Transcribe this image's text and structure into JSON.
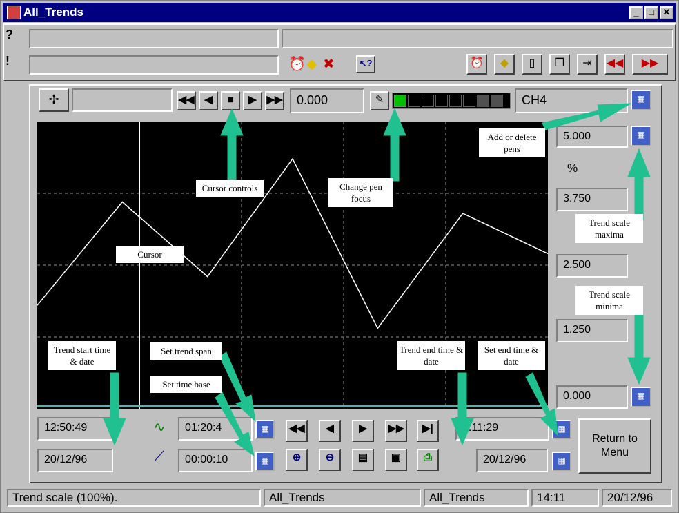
{
  "window": {
    "title": "All_Trends",
    "min_label": "_",
    "max_label": "□",
    "close_label": "✕"
  },
  "menu": {
    "help_label": "?",
    "alert_label": "!"
  },
  "cursor_toolbar": {
    "value": "0.000",
    "pen_name": "CH4",
    "btn_rewind": "◀◀",
    "btn_back": "◀",
    "btn_stop": "■",
    "btn_fwd": "▶",
    "btn_ffwd": "▶▶"
  },
  "scale": {
    "max": "5.000",
    "unit": "%",
    "v3750": "3.750",
    "v2500": "2.500",
    "v1250": "1.250",
    "min": "0.000"
  },
  "bottom": {
    "start_time": "12:50:49",
    "start_date": "20/12/96",
    "span": "01:20:4",
    "time_base": "00:00:10",
    "end_time": "4:11:29",
    "end_date": "20/12/96",
    "return_label": "Return to Menu"
  },
  "statusbar": {
    "message": "Trend scale (100%).",
    "panel2": "All_Trends",
    "panel3": "All_Trends",
    "time": "14:11",
    "date": "20/12/96"
  },
  "annotations": {
    "cursor_controls": "Cursor controls",
    "change_pen": "Change pen focus",
    "add_pens": "Add or delete pens",
    "cursor": "Cursor",
    "scale_max": "Trend scale maxima",
    "scale_min": "Trend scale minima",
    "trend_start": "Trend start time & date",
    "set_span": "Set trend span",
    "set_base": "Set time base",
    "trend_end": "Trend end time & date",
    "set_end": "Set end time & date"
  },
  "chart_data": {
    "type": "line",
    "series": [
      {
        "values": [
          1.8,
          3.6,
          2.3,
          4.35,
          1.4,
          3.4,
          2.7
        ]
      }
    ],
    "ylim": [
      0,
      5
    ],
    "grid": true
  },
  "colors": {
    "plot_bg": "#000000",
    "line": "#ffffff",
    "arrow": "#20c090",
    "title_bg": "#000080"
  }
}
